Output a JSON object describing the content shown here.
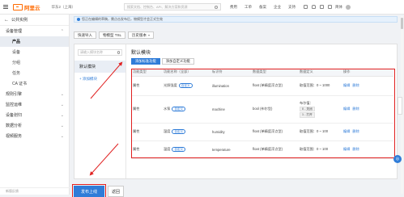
{
  "topbar": {
    "logo_text": "阿里云",
    "region": "华东2（上海）",
    "search_placeholder": "搜索文档、控制台、API、解决方案和资源",
    "links": [
      "费用",
      "工单",
      "备案",
      "企业",
      "支持"
    ],
    "lang": "简体",
    "accent": "#ff6a00"
  },
  "sidebar": {
    "back_label": "公共实例",
    "groups": [
      {
        "label": "设备管理",
        "expanded": true,
        "items": [
          {
            "label": "产品",
            "active": true
          },
          {
            "label": "设备",
            "active": false
          },
          {
            "label": "分组",
            "active": false
          },
          {
            "label": "任务",
            "active": false
          },
          {
            "label": "CA 证书",
            "active": false
          }
        ]
      },
      {
        "label": "规则引擎",
        "expanded": false,
        "items": []
      },
      {
        "label": "监控运维",
        "expanded": false,
        "items": []
      },
      {
        "label": "设备划归",
        "expanded": false,
        "items": []
      },
      {
        "label": "数据分析",
        "expanded": false,
        "items": []
      },
      {
        "label": "视频服务",
        "expanded": false,
        "items": []
      }
    ],
    "footer": "新版反馈"
  },
  "main": {
    "notice": "您正在编辑的草稿，需点击发布后，物模型才会正式生效",
    "toolbar": {
      "buttons": [
        {
          "label": "快速导入",
          "has_chevron": false
        },
        {
          "label": "物模型 TSL",
          "has_chevron": false
        },
        {
          "label": "历史版本",
          "has_chevron": true
        }
      ]
    },
    "module_list": {
      "search_placeholder": "请输入模块名称",
      "default_module": "默认模块",
      "add_module": "+ 添加模块"
    },
    "module": {
      "title": "默认模块",
      "tabs": [
        "添加标准功能",
        "添加自定义功能"
      ],
      "columns": [
        "功能类型",
        "功能名称（全部）",
        "标识符",
        "数据类型",
        "数据定义",
        "操作"
      ],
      "rows": [
        {
          "type": "属性",
          "name": "光照强度",
          "badge": "自定义",
          "identifier": "illumination",
          "dtype": "float (单精度浮点型)",
          "definition": [
            "取值范围：0 ~ 1000"
          ],
          "ops": [
            "编辑",
            "删除"
          ]
        },
        {
          "type": "属性",
          "name": "水泵",
          "badge": "自定义",
          "identifier": "machine",
          "dtype": "bool (布尔型)",
          "definition": [
            "布尔值：",
            "0 - 关闭",
            "1 - 打开"
          ],
          "ops": [
            "编辑",
            "删除"
          ]
        },
        {
          "type": "属性",
          "name": "湿度",
          "badge": "自定义",
          "identifier": "humidity",
          "dtype": "float (单精度浮点型)",
          "definition": [
            "取值范围：0 ~ 100"
          ],
          "ops": [
            "编辑",
            "删除"
          ]
        },
        {
          "type": "属性",
          "name": "温度",
          "badge": "自定义",
          "identifier": "temperature",
          "dtype": "float (单精度浮点型)",
          "definition": [
            "取值范围：0 ~ 100"
          ],
          "ops": [
            "编辑",
            "删除"
          ]
        }
      ]
    },
    "footer": {
      "publish_label": "发布上线",
      "back_label": "返回"
    }
  },
  "colors": {
    "primary": "#2f7cd8",
    "highlight": "#e02020"
  }
}
